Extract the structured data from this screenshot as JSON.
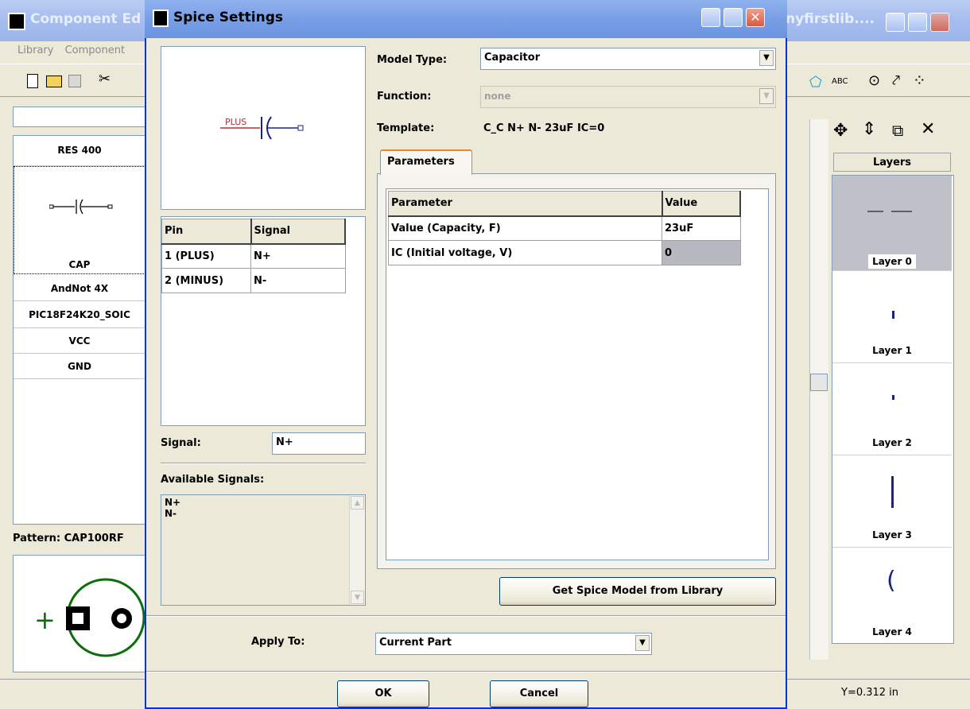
{
  "bg_window": {
    "title_left": "Component Ed",
    "title_right": "nyfirstlib....",
    "menu": [
      "Library",
      "Component"
    ],
    "components": [
      "RES 400",
      "CAP",
      "AndNot 4X",
      "PIC18F24K20_SOIC",
      "VCC",
      "GND"
    ],
    "pattern_label": "Pattern: CAP100RF",
    "layers_header": "Layers",
    "layers": [
      "Layer 0",
      "Layer 1",
      "Layer 2",
      "Layer 3",
      "Layer 4"
    ],
    "status_coord": "Y=0.312 in",
    "abc_label": "ABC"
  },
  "dialog": {
    "title": "Spice Settings",
    "preview_pin_label": "PLUS",
    "pins_table": {
      "headers": [
        "Pin",
        "Signal"
      ],
      "rows": [
        [
          "1 (PLUS)",
          "N+"
        ],
        [
          "2 (MINUS)",
          "N-"
        ]
      ]
    },
    "signal_label": "Signal:",
    "signal_value": "N+",
    "available_label": "Available Signals:",
    "available_signals": [
      "N+",
      "N-"
    ],
    "model_type_label": "Model Type:",
    "model_type_value": "Capacitor",
    "function_label": "Function:",
    "function_value": "none",
    "template_label": "Template:",
    "template_value": "C_C N+ N- 23uF IC=0",
    "tab_parameters": "Parameters",
    "params_table": {
      "headers": [
        "Parameter",
        "Value"
      ],
      "rows": [
        [
          "Value (Capacity, F)",
          "23uF"
        ],
        [
          "IC (Initial voltage, V)",
          "0"
        ]
      ]
    },
    "get_model_button": "Get Spice Model from Library",
    "apply_to_label": "Apply To:",
    "apply_to_value": "Current Part",
    "ok_button": "OK",
    "cancel_button": "Cancel"
  }
}
